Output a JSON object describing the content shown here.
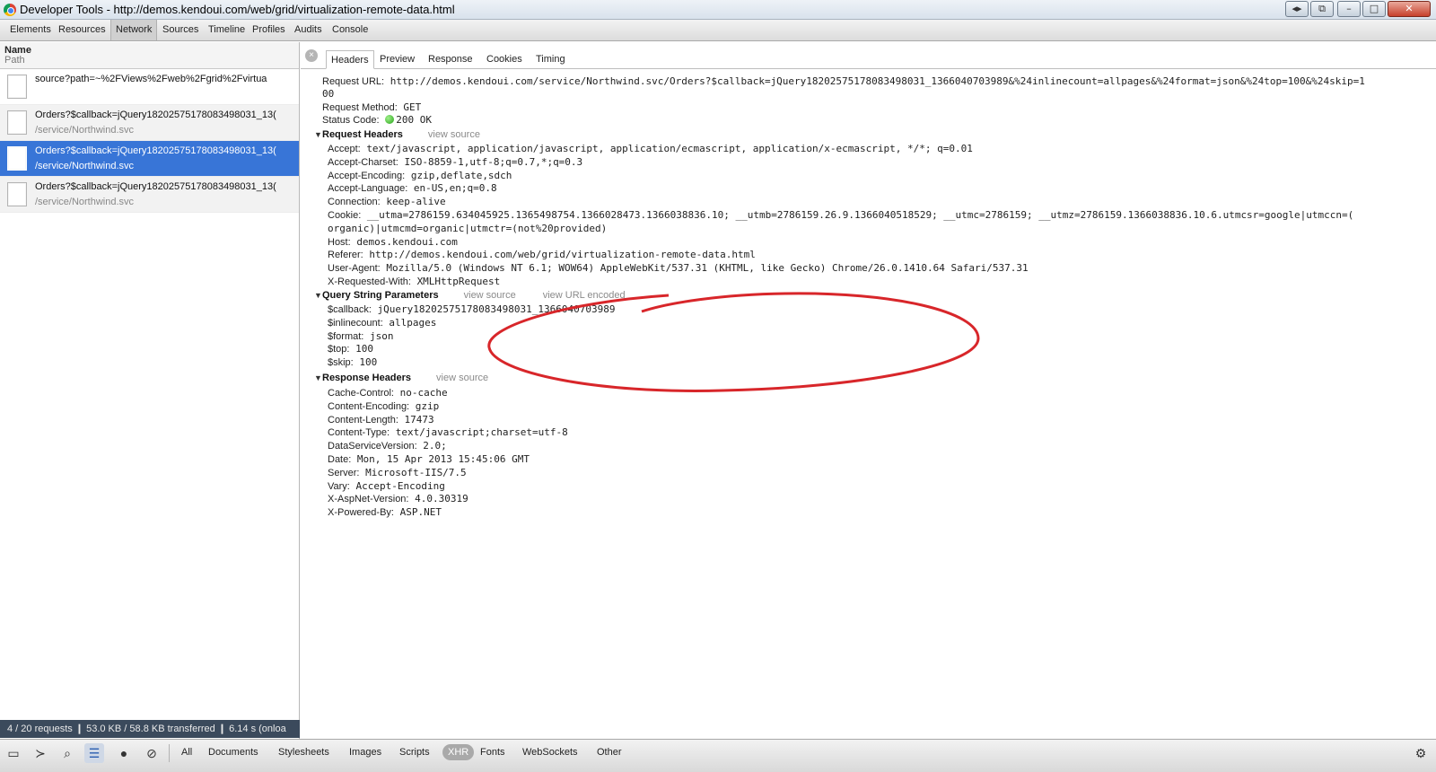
{
  "window": {
    "title": "Developer Tools - http://demos.kendoui.com/web/grid/virtualization-remote-data.html",
    "controls": {
      "dock": "◂▸",
      "restore2": "⧉",
      "min": "–",
      "max": "□",
      "close": "✕"
    }
  },
  "toolbar": {
    "items": [
      "Elements",
      "Resources",
      "Network",
      "Sources",
      "Timeline",
      "Profiles",
      "Audits",
      "Console"
    ]
  },
  "network": {
    "header": {
      "name": "Name",
      "path": "Path"
    },
    "requests": [
      {
        "name": "source?path=~%2FViews%2Fweb%2Fgrid%2Fvirtua",
        "path": ""
      },
      {
        "name": "Orders?$callback=jQuery18202575178083498031_13(",
        "path": "/service/Northwind.svc"
      },
      {
        "name": "Orders?$callback=jQuery18202575178083498031_13(",
        "path": "/service/Northwind.svc"
      },
      {
        "name": "Orders?$callback=jQuery18202575178083498031_13(",
        "path": "/service/Northwind.svc"
      }
    ],
    "summary": "4 / 20 requests  ❙  53.0 KB / 58.8 KB transferred  ❙  6.14 s (onloa"
  },
  "detail": {
    "close": "×",
    "tabs": [
      "Headers",
      "Preview",
      "Response",
      "Cookies",
      "Timing"
    ],
    "general": {
      "url_key": "Request URL:",
      "url_line1": "http://demos.kendoui.com/service/Northwind.svc/Orders?$callback=jQuery18202575178083498031_1366040703989&%24inlinecount=allpages&%24format=json&%24top=100&%24skip=1",
      "url_line2": "00",
      "method_key": "Request Method:",
      "method": "GET",
      "status_key": "Status Code:",
      "status": "200 OK",
      "status_color": "#27a31a"
    },
    "request_headers": {
      "title": "Request Headers",
      "view_source": "view source",
      "items": [
        {
          "k": "Accept:",
          "v": "text/javascript, application/javascript, application/ecmascript, application/x-ecmascript, */*; q=0.01"
        },
        {
          "k": "Accept-Charset:",
          "v": "ISO-8859-1,utf-8;q=0.7,*;q=0.3"
        },
        {
          "k": "Accept-Encoding:",
          "v": "gzip,deflate,sdch"
        },
        {
          "k": "Accept-Language:",
          "v": "en-US,en;q=0.8"
        },
        {
          "k": "Connection:",
          "v": "keep-alive"
        },
        {
          "k": "Cookie:",
          "v": "__utma=2786159.634045925.1365498754.1366028473.1366038836.10; __utmb=2786159.26.9.1366040518529; __utmc=2786159; __utmz=2786159.1366038836.10.6.utmcsr=google|utmccn=("
        },
        {
          "k": "",
          "v": "organic)|utmcmd=organic|utmctr=(not%20provided)"
        },
        {
          "k": "Host:",
          "v": "demos.kendoui.com"
        },
        {
          "k": "Referer:",
          "v": "http://demos.kendoui.com/web/grid/virtualization-remote-data.html"
        },
        {
          "k": "User-Agent:",
          "v": "Mozilla/5.0 (Windows NT 6.1; WOW64) AppleWebKit/537.31 (KHTML, like Gecko) Chrome/26.0.1410.64 Safari/537.31"
        },
        {
          "k": "X-Requested-With:",
          "v": "XMLHttpRequest"
        }
      ]
    },
    "query_params": {
      "title": "Query String Parameters",
      "view_source": "view source",
      "view_url_encoded": "view URL encoded",
      "items": [
        {
          "k": "$callback:",
          "v": "jQuery18202575178083498031_1366040703989"
        },
        {
          "k": "$inlinecount:",
          "v": "allpages"
        },
        {
          "k": "$format:",
          "v": "json"
        },
        {
          "k": "$top:",
          "v": "100"
        },
        {
          "k": "$skip:",
          "v": "100"
        }
      ]
    },
    "response_headers": {
      "title": "Response Headers",
      "view_source": "view source",
      "items": [
        {
          "k": "Cache-Control:",
          "v": "no-cache"
        },
        {
          "k": "Content-Encoding:",
          "v": "gzip"
        },
        {
          "k": "Content-Length:",
          "v": "17473"
        },
        {
          "k": "Content-Type:",
          "v": "text/javascript;charset=utf-8"
        },
        {
          "k": "DataServiceVersion:",
          "v": "2.0;"
        },
        {
          "k": "Date:",
          "v": "Mon, 15 Apr 2013 15:45:06 GMT"
        },
        {
          "k": "Server:",
          "v": "Microsoft-IIS/7.5"
        },
        {
          "k": "Vary:",
          "v": "Accept-Encoding"
        },
        {
          "k": "X-AspNet-Version:",
          "v": "4.0.30319"
        },
        {
          "k": "X-Powered-By:",
          "v": "ASP.NET"
        }
      ]
    },
    "annotation_color": "#d8262a"
  },
  "bottombar": {
    "icons": [
      "dock-icon",
      "console-icon",
      "search-icon",
      "list-view-icon",
      "record-icon",
      "clear-icon"
    ],
    "filters": [
      "All",
      "Documents",
      "Stylesheets",
      "Images",
      "Scripts",
      "XHR",
      "Fonts",
      "WebSockets",
      "Other"
    ],
    "active_filter": "XHR",
    "settings": "⚙"
  }
}
